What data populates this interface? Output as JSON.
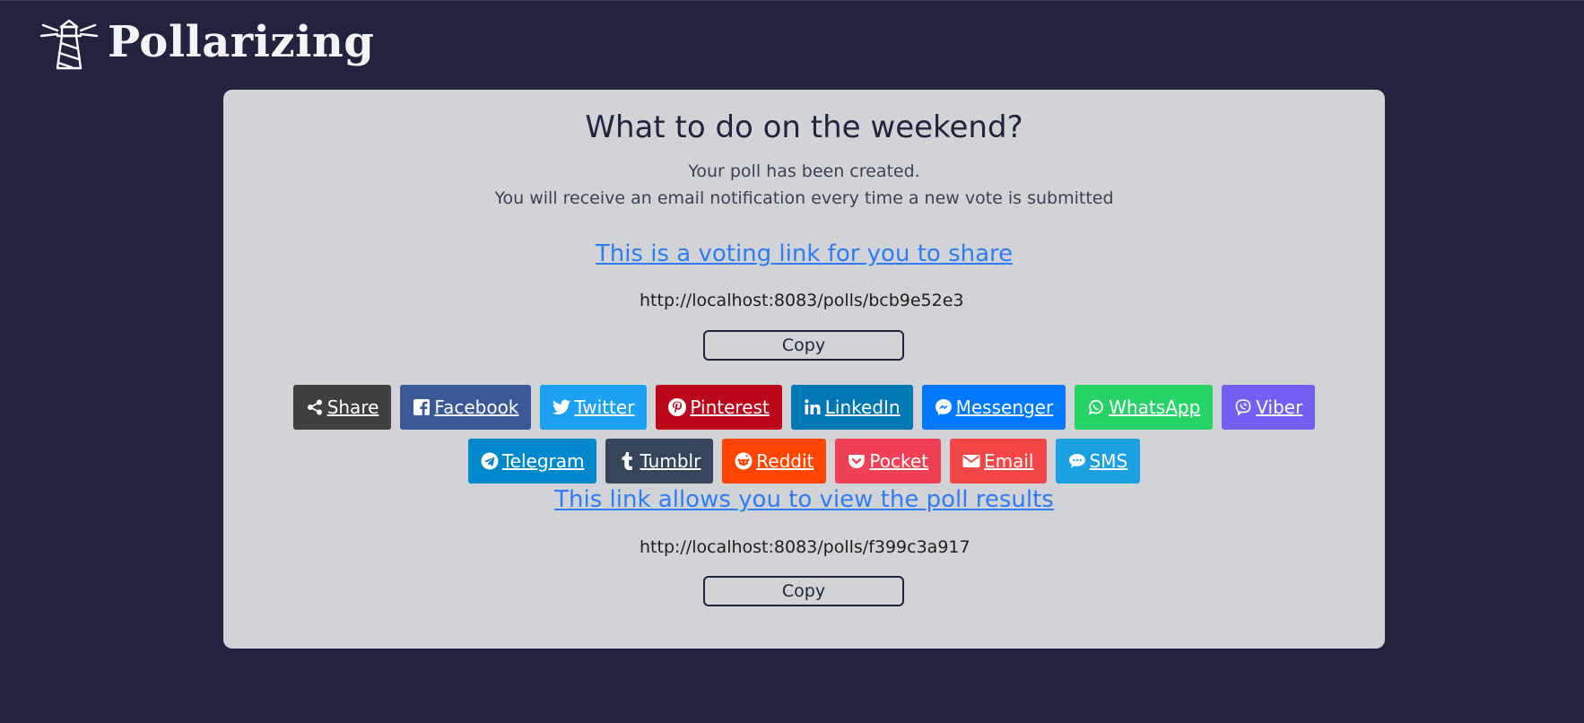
{
  "brand": {
    "name": "Pollarizing",
    "logo_icon": "lighthouse-icon"
  },
  "poll": {
    "title": "What to do on the weekend?",
    "created_message": "Your poll has been created.",
    "notification_message": "You will receive an email notification every time a new vote is submitted"
  },
  "voting": {
    "heading": "This is a voting link for you to share",
    "url": "http://localhost:8083/polls/bcb9e52e3",
    "copy_label": "Copy"
  },
  "share_buttons": [
    {
      "label": "Share",
      "icon": "share-icon",
      "color": "#404040"
    },
    {
      "label": "Facebook",
      "icon": "facebook-icon",
      "color": "#3b5998"
    },
    {
      "label": "Twitter",
      "icon": "twitter-icon",
      "color": "#1da1f2"
    },
    {
      "label": "Pinterest",
      "icon": "pinterest-icon",
      "color": "#bd081c"
    },
    {
      "label": "LinkedIn",
      "icon": "linkedin-icon",
      "color": "#0077b5"
    },
    {
      "label": "Messenger",
      "icon": "messenger-icon",
      "color": "#0078ff"
    },
    {
      "label": "WhatsApp",
      "icon": "whatsapp-icon",
      "color": "#25d366"
    },
    {
      "label": "Viber",
      "icon": "viber-icon",
      "color": "#7360f2"
    },
    {
      "label": "Telegram",
      "icon": "telegram-icon",
      "color": "#0088cc"
    },
    {
      "label": "Tumblr",
      "icon": "tumblr-icon",
      "color": "#35465c"
    },
    {
      "label": "Reddit",
      "icon": "reddit-icon",
      "color": "#ff4500"
    },
    {
      "label": "Pocket",
      "icon": "pocket-icon",
      "color": "#ef4056"
    },
    {
      "label": "Email",
      "icon": "email-icon",
      "color": "#f24545"
    },
    {
      "label": "SMS",
      "icon": "sms-icon",
      "color": "#1ba1e2"
    }
  ],
  "results": {
    "heading": "This link allows you to view the poll results",
    "url": "http://localhost:8083/polls/f399c3a917",
    "copy_label": "Copy"
  }
}
